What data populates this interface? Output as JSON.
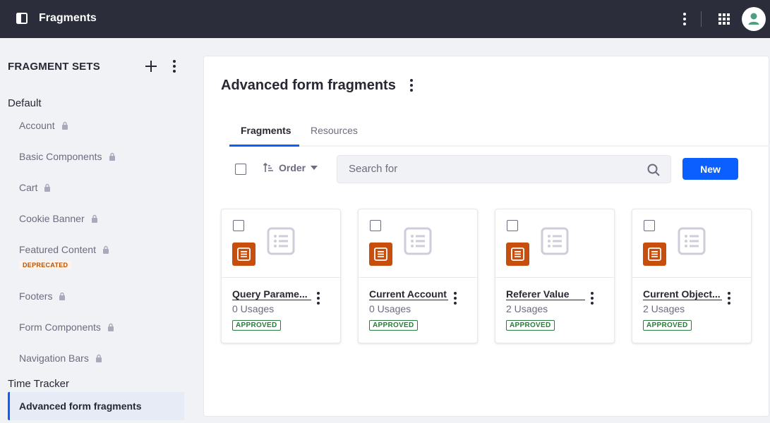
{
  "app": {
    "title": "Fragments",
    "accent": "#0b5fff",
    "topbar_bg": "#2b2d3a"
  },
  "sidebar": {
    "heading": "FRAGMENT SETS",
    "groups": [
      {
        "label": "Default",
        "items": [
          {
            "label": "Account",
            "locked": true
          },
          {
            "label": "Basic Components",
            "locked": true
          },
          {
            "label": "Cart",
            "locked": true
          },
          {
            "label": "Cookie Banner",
            "locked": true
          },
          {
            "label": "Featured Content",
            "locked": true,
            "badge": "DEPRECATED"
          },
          {
            "label": "Footers",
            "locked": true
          },
          {
            "label": "Form Components",
            "locked": true
          },
          {
            "label": "Navigation Bars",
            "locked": true
          }
        ]
      },
      {
        "label": "Time Tracker",
        "items": [
          {
            "label": "Advanced form fragments",
            "locked": false,
            "active": true
          }
        ]
      }
    ]
  },
  "main": {
    "title": "Advanced form fragments",
    "tabs": [
      {
        "label": "Fragments",
        "active": true
      },
      {
        "label": "Resources",
        "active": false
      }
    ],
    "toolbar": {
      "order_label": "Order",
      "search_placeholder": "Search for",
      "new_label": "New"
    },
    "cards": [
      {
        "name": "Query Parame...",
        "usages": "0 Usages",
        "status": "APPROVED"
      },
      {
        "name": "Current Account",
        "usages": "0 Usages",
        "status": "APPROVED"
      },
      {
        "name": "Referer Value",
        "usages": "2 Usages",
        "status": "APPROVED"
      },
      {
        "name": "Current Object...",
        "usages": "2 Usages",
        "status": "APPROVED"
      }
    ]
  }
}
